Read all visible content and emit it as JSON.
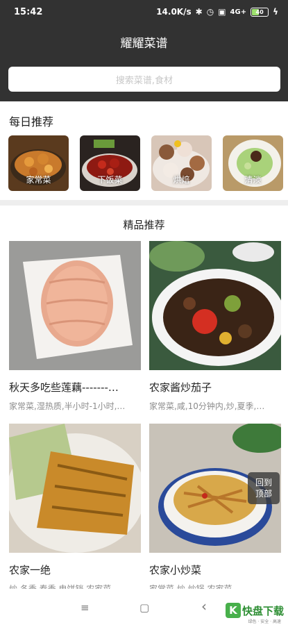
{
  "status_bar": {
    "time": "15:42",
    "speed": "14.0K/s",
    "network": "4G+",
    "battery": "40"
  },
  "header": {
    "title": "耀耀菜谱"
  },
  "search": {
    "placeholder": "搜索菜谱,食材"
  },
  "daily": {
    "title": "每日推荐",
    "items": [
      {
        "label": "家常菜"
      },
      {
        "label": "下饭菜"
      },
      {
        "label": "烘焙"
      },
      {
        "label": "清淡"
      }
    ]
  },
  "featured": {
    "title": "精品推荐",
    "items": [
      {
        "name": "秋天多吃些莲藕-------…",
        "tags": "家常菜,湿热质,半小时-1小时,…"
      },
      {
        "name": "农家酱炒茄子",
        "tags": "家常菜,咸,10分钟内,炒,夏季,…"
      },
      {
        "name": "农家一绝",
        "tags": "炒,冬季,春季,电饼铛,农家菜,…"
      },
      {
        "name": "农家小炒菜",
        "tags": "家常菜,炒,炒锅,农家菜,…"
      }
    ]
  },
  "back_to_top": {
    "line1": "回到",
    "line2": "顶部"
  },
  "nav": {
    "menu": "≡",
    "home": "▢",
    "back": "‹"
  },
  "brand": {
    "mark": "K",
    "name": "快盘下载",
    "slogan": "绿色 · 安全 · 高速"
  }
}
